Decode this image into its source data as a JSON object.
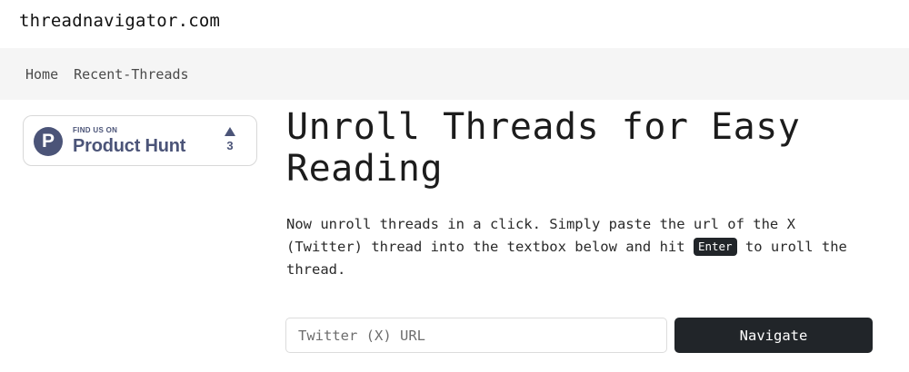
{
  "site": {
    "title": "threadnavigator.com"
  },
  "nav": {
    "items": [
      {
        "label": "Home"
      },
      {
        "label": "Recent-Threads"
      }
    ]
  },
  "product_hunt": {
    "small_text": "FIND US ON",
    "big_text": "Product Hunt",
    "logo_letter": "P",
    "votes": "3",
    "brand_color": "#4b5478",
    "icons": [
      "product-hunt-logo-icon",
      "upvote-arrow-icon"
    ]
  },
  "main": {
    "title": "Unroll Threads for Easy Reading",
    "description_before": "Now unroll threads in a click. Simply paste the url of the X (Twitter) thread into the textbox below and hit ",
    "key_label": "Enter",
    "description_after": " to uroll the thread."
  },
  "form": {
    "placeholder": "Twitter (X) URL",
    "value": "",
    "button_label": "Navigate",
    "button_color": "#212529"
  }
}
